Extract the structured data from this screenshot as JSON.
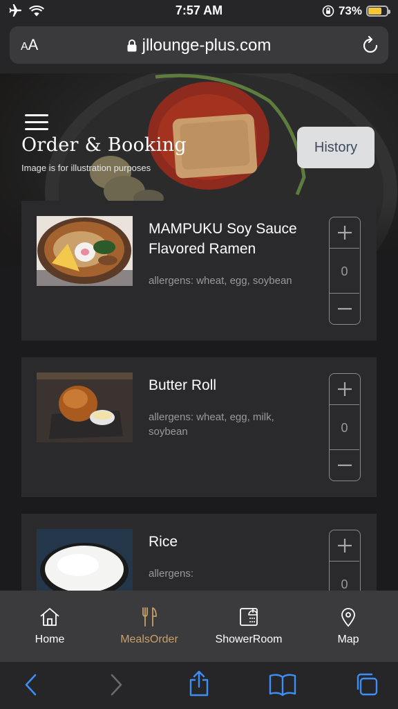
{
  "status": {
    "time": "7:57 AM",
    "battery_pct": "73%",
    "battery_level": 0.73
  },
  "browser": {
    "aa_small": "A",
    "aa_large": "A",
    "url": "jllounge-plus.com"
  },
  "header": {
    "title": "Order & Booking",
    "subtitle": "Image is for illustration purposes",
    "history_label": "History"
  },
  "menu_items": [
    {
      "name": "MAMPUKU Soy Sauce Flavored Ramen",
      "allergens": "allergens: wheat, egg, soybean",
      "qty": "0"
    },
    {
      "name": "Butter Roll",
      "allergens": "allergens: wheat, egg, milk, soybean",
      "qty": "0"
    },
    {
      "name": "Rice",
      "allergens": "allergens:",
      "qty": "0"
    }
  ],
  "nav": {
    "items": [
      {
        "label": "Home",
        "icon": "home-icon"
      },
      {
        "label": "MealsOrder",
        "icon": "fork-knife-icon"
      },
      {
        "label": "ShowerRoom",
        "icon": "shower-icon"
      },
      {
        "label": "Map",
        "icon": "map-pin-icon"
      }
    ],
    "active": "MealsOrder"
  },
  "colors": {
    "accent": "#c9a06a",
    "browser_blue": "#3d8ff7",
    "battery": "#f4c534"
  }
}
